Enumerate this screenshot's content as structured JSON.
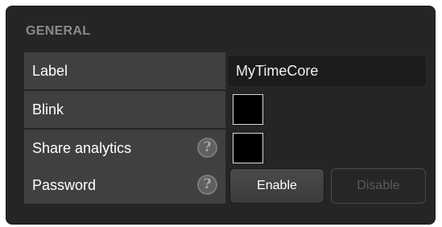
{
  "section": {
    "title": "GENERAL"
  },
  "rows": [
    {
      "label": "Label",
      "value": "MyTimeCore"
    },
    {
      "label": "Blink",
      "checked": false
    },
    {
      "label": "Share analytics",
      "checked": false,
      "help": "?"
    },
    {
      "label": "Password",
      "help": "?",
      "enable_label": "Enable",
      "disable_label": "Disable",
      "active": "Enable"
    }
  ],
  "colors": {
    "panel_bg": "#252525",
    "row_label_bg": "#404040",
    "checkbox_fill": "#000000"
  }
}
